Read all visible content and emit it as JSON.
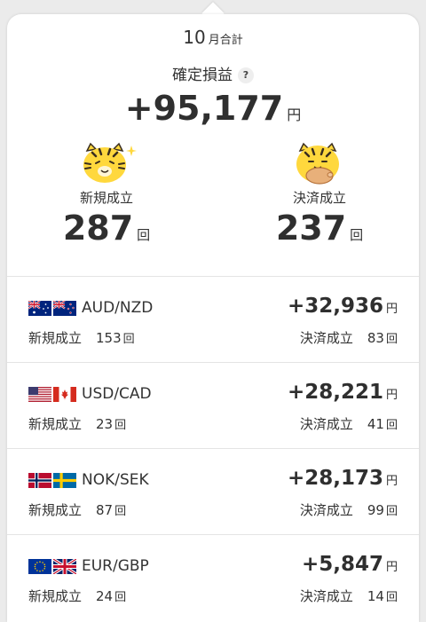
{
  "header": {
    "month_number": "10",
    "month_suffix": "月合計",
    "profit_label": "確定損益",
    "help_glyph": "?",
    "total_profit": "+95,177",
    "currency_unit": "円"
  },
  "summary": {
    "new_label": "新規成立",
    "new_count": "287",
    "settle_label": "決済成立",
    "settle_count": "237",
    "count_unit": "回"
  },
  "pairs": [
    {
      "pair": "AUD/NZD",
      "profit": "+32,936",
      "unit": "円",
      "new_label": "新規成立",
      "new_count": "153",
      "settle_label": "決済成立",
      "settle_count": "83",
      "count_unit": "回",
      "flags": [
        "australia-flag-icon",
        "new-zealand-flag-icon"
      ]
    },
    {
      "pair": "USD/CAD",
      "profit": "+28,221",
      "unit": "円",
      "new_label": "新規成立",
      "new_count": "23",
      "settle_label": "決済成立",
      "settle_count": "41",
      "count_unit": "回",
      "flags": [
        "united-states-flag-icon",
        "canada-flag-icon"
      ]
    },
    {
      "pair": "NOK/SEK",
      "profit": "+28,173",
      "unit": "円",
      "new_label": "新規成立",
      "new_count": "87",
      "settle_label": "決済成立",
      "settle_count": "99",
      "count_unit": "回",
      "flags": [
        "norway-flag-icon",
        "sweden-flag-icon"
      ]
    },
    {
      "pair": "EUR/GBP",
      "profit": "+5,847",
      "unit": "円",
      "new_label": "新規成立",
      "new_count": "24",
      "settle_label": "決済成立",
      "settle_count": "14",
      "count_unit": "回",
      "flags": [
        "european-union-flag-icon",
        "united-kingdom-flag-icon"
      ]
    }
  ],
  "colors": {
    "tiger_yellow": "#ffd83d",
    "tiger_stripe": "#3a2e1f",
    "background": "#ebebeb",
    "card": "#ffffff"
  }
}
